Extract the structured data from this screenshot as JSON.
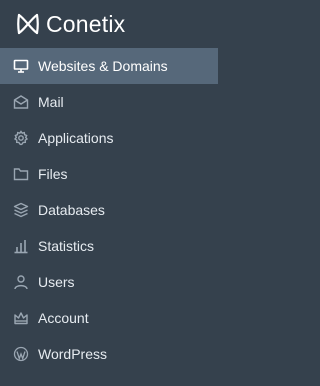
{
  "brand": {
    "name": "Conetix",
    "logo_icon": "conetix-logo-icon"
  },
  "colors": {
    "sidebar_bg": "#35414d",
    "active_bg": "#56687a",
    "text": "#e6ebf0",
    "icon": "#9aa6b2"
  },
  "nav": {
    "active_index": 0,
    "items": [
      {
        "label": "Websites & Domains",
        "icon": "monitor-icon"
      },
      {
        "label": "Mail",
        "icon": "envelope-icon"
      },
      {
        "label": "Applications",
        "icon": "gear-icon"
      },
      {
        "label": "Files",
        "icon": "folder-icon"
      },
      {
        "label": "Databases",
        "icon": "database-icon"
      },
      {
        "label": "Statistics",
        "icon": "bar-chart-icon"
      },
      {
        "label": "Users",
        "icon": "user-icon"
      },
      {
        "label": "Account",
        "icon": "account-crown-icon"
      },
      {
        "label": "WordPress",
        "icon": "wordpress-icon"
      }
    ]
  }
}
